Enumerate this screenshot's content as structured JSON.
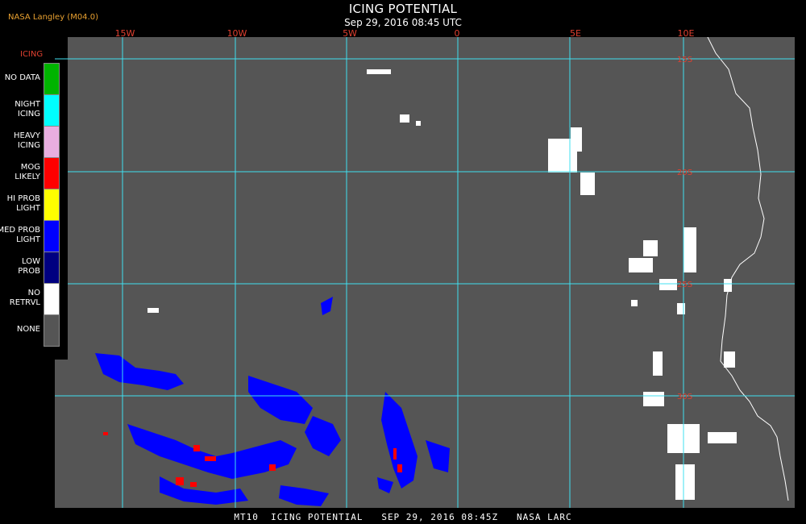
{
  "header": {
    "credit": "NASA Langley (M04.0)",
    "title": "ICING POTENTIAL",
    "timestamp": "Sep 29, 2016 08:45 UTC"
  },
  "longitude_labels": [
    "15W",
    "10W",
    "5W",
    "0",
    "5E",
    "10E"
  ],
  "latitude_labels": [
    "15S",
    "20S",
    "25S",
    "30S"
  ],
  "legend": {
    "title": "ICING",
    "items": [
      {
        "label": "NO DATA",
        "color": "#00b400"
      },
      {
        "label": "NIGHT\nICING",
        "color": "#00ffff"
      },
      {
        "label": "HEAVY\nICING",
        "color": "#e8aee0"
      },
      {
        "label": "MOG\nLIKELY",
        "color": "#ff0000"
      },
      {
        "label": "HI PROB\nLIGHT",
        "color": "#ffff00"
      },
      {
        "label": "MED PROB\nLIGHT",
        "color": "#0000ff"
      },
      {
        "label": "LOW\nPROB",
        "color": "#000080"
      },
      {
        "label": "NO\nRETRVL",
        "color": "#ffffff"
      },
      {
        "label": "NONE",
        "color": "#555555"
      }
    ]
  },
  "colors": {
    "background": "#555555",
    "grid": "#40e0f0",
    "coastline": "#ffffff",
    "label_red": "#e04030"
  },
  "footer": "MT10  ICING POTENTIAL   SEP 29, 2016 08:45Z   NASA LARC"
}
